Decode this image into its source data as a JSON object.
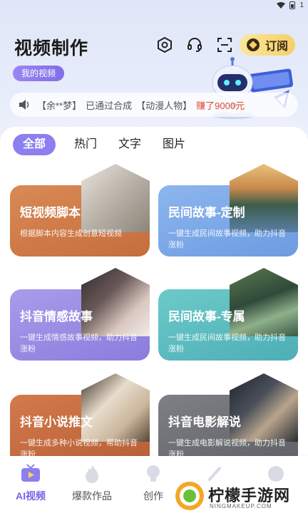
{
  "status_bar": {
    "number": "1"
  },
  "header": {
    "title": "视频制作",
    "subscribe_label": "订阅"
  },
  "my_videos_label": "我的视频",
  "ticker": {
    "user": "【余**梦】",
    "action": "已通过合成",
    "category": "【动漫人物】",
    "earned": "赚了9000元"
  },
  "tabs": [
    {
      "label": "全部",
      "active": true
    },
    {
      "label": "热门"
    },
    {
      "label": "文字"
    },
    {
      "label": "图片"
    }
  ],
  "cards": [
    {
      "title": "短视频脚本",
      "desc": "根据脚本内容生成创意短视频",
      "bg": "#cf7a47"
    },
    {
      "title": "民间故事-定制",
      "desc": "一键生成民间故事视频，助力抖音涨粉",
      "bg": "#79a8e6"
    },
    {
      "title": "抖音情感故事",
      "desc": "一键生成情感故事视频，助力抖音涨粉",
      "bg": "#9a8de4"
    },
    {
      "title": "民间故事-专属",
      "desc": "一键生成民间故事视频，助力抖音涨粉",
      "bg": "#5fbcc0"
    },
    {
      "title": "抖音小说推文",
      "desc": "一键生成多种小说视频，帮助抖音涨粉",
      "bg": "#c76a42"
    },
    {
      "title": "抖音电影解说",
      "desc": "一键生成电影解说视频，助力抖音涨粉",
      "bg": "#6f7177"
    }
  ],
  "bottom_nav": [
    {
      "label": "AI视频",
      "icon": "tv-icon",
      "active": true
    },
    {
      "label": "爆款作品",
      "icon": "flame-icon"
    },
    {
      "label": "创作",
      "icon": "lightbulb-icon"
    },
    {
      "label": "",
      "icon": "pen-icon"
    },
    {
      "label": "",
      "icon": "profile-icon"
    }
  ],
  "watermark": {
    "text": "柠檬手游网",
    "sub": "NINGMAKEUP.COM"
  },
  "colors": {
    "accent": "#8c7ff0",
    "highlight": "#e0452d",
    "vip": "#f6cf6a"
  }
}
